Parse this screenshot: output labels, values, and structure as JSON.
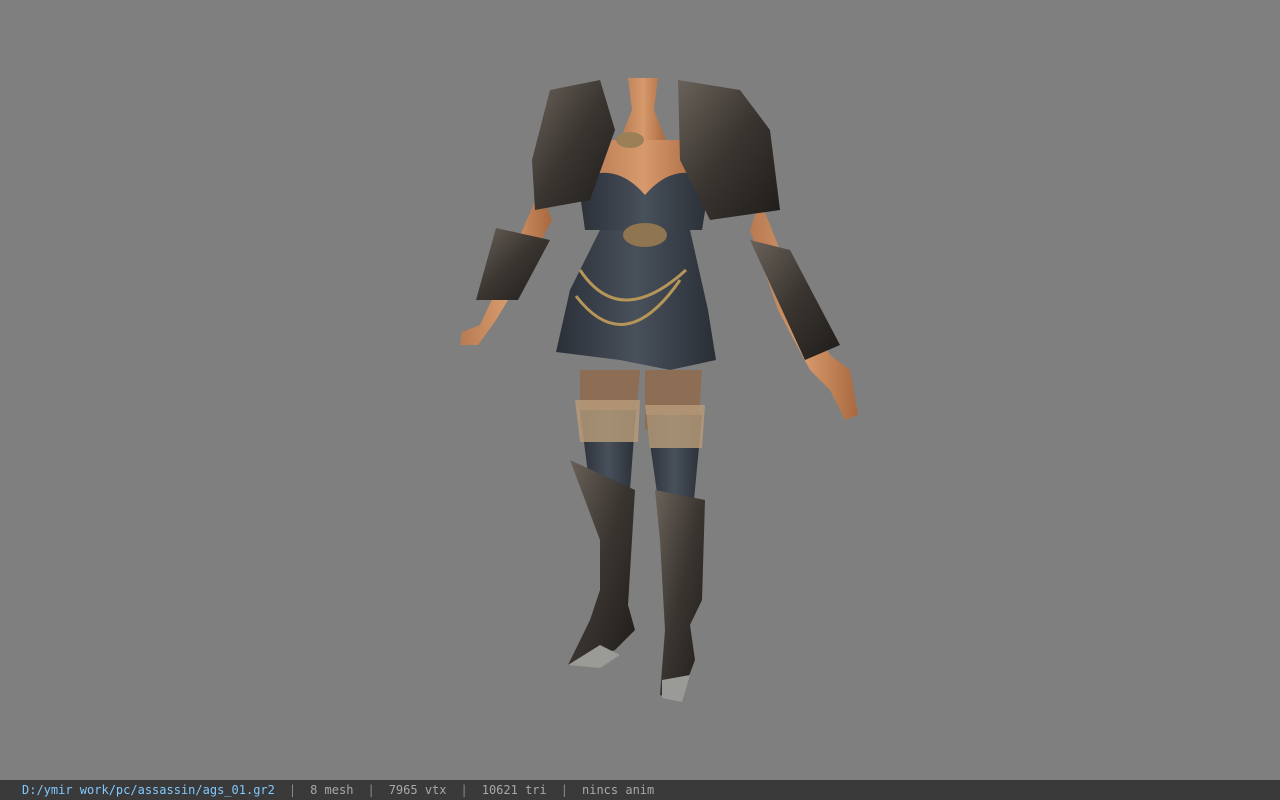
{
  "viewport": {
    "background": "#7f7f7f",
    "model_name": "assassin armor model"
  },
  "status_bar": {
    "file_path": "D:/ymir work/pc/assassin/ags_01.gr2",
    "separator": "|",
    "mesh_count": "8 mesh",
    "vertex_count": "7965 vtx",
    "triangle_count": "10621 tri",
    "animation": "nincs anim",
    "path_color": "#7fc9ff",
    "text_color": "#a8a8a8"
  }
}
